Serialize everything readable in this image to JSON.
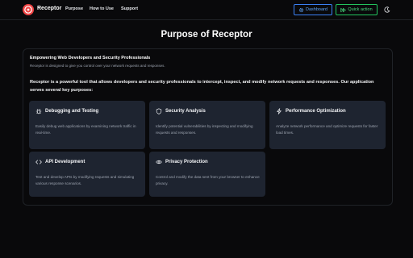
{
  "nav": {
    "brand": "Receptor",
    "links": [
      "Purpose",
      "How to Use",
      "Support"
    ],
    "dashboard_label": "Dashboard",
    "quick_label": "Quick action"
  },
  "page": {
    "title": "Purpose of Receptor",
    "heading": "Empowering Web Developers and Security Professionals",
    "subheading": "Receptor is designed to give you control over your network requests and responses.",
    "intro": "Receptor is a powerful tool that allows developers and security professionals to intercept, inspect, and modify network requests and responses. Our application serves several key purposes:"
  },
  "cards": [
    {
      "icon": "bug-icon",
      "title": "Debugging and Testing",
      "desc": "Easily debug web applications by examining network traffic in real-time."
    },
    {
      "icon": "shield-icon",
      "title": "Security Analysis",
      "desc": "Identify potential vulnerabilities by inspecting and modifying requests and responses."
    },
    {
      "icon": "bolt-icon",
      "title": "Performance Optimization",
      "desc": "Analyze network performance and optimize requests for faster load times."
    },
    {
      "icon": "code-icon",
      "title": "API Development",
      "desc": "Test and develop APIs by modifying requests and simulating various response scenarios."
    },
    {
      "icon": "eye-icon",
      "title": "Privacy Protection",
      "desc": "Control and modify the data sent from your browser to enhance privacy."
    }
  ],
  "colors": {
    "dashboard": "#3b82f6",
    "quick_action": "#22c55e",
    "logo": "#ef4444",
    "card_bg": "#1e2430"
  }
}
